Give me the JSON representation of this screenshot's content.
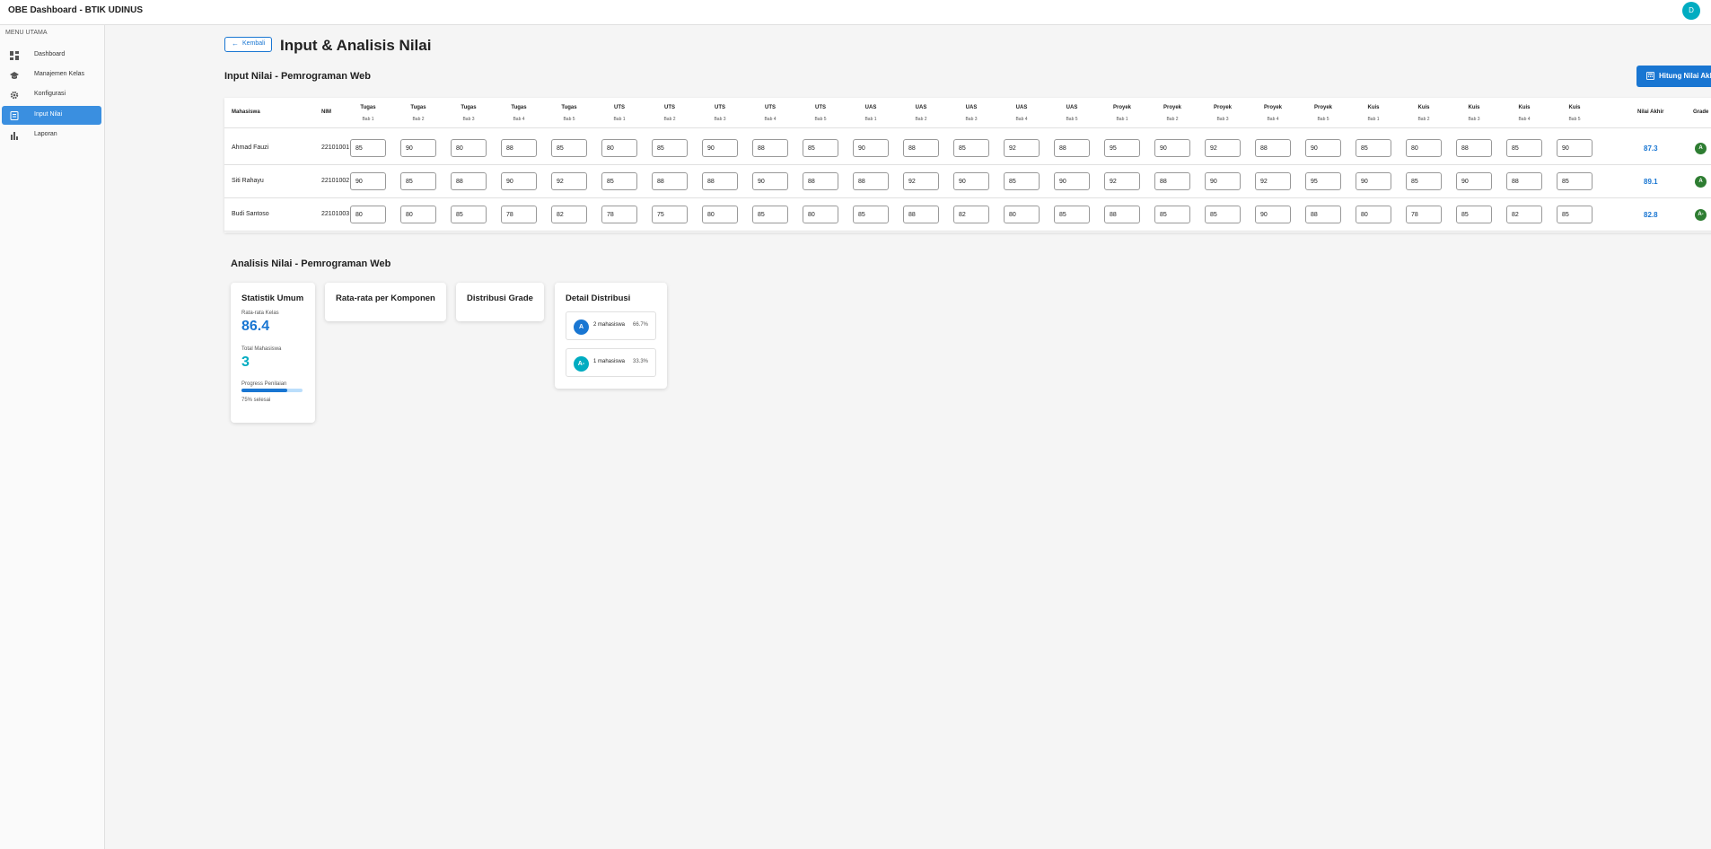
{
  "app": {
    "title": "OBE Dashboard - BTIK UDINUS",
    "avatar_initial": "D"
  },
  "sidebar": {
    "heading": "MENU UTAMA",
    "items": [
      {
        "label": "Dashboard",
        "icon": "dashboard-icon"
      },
      {
        "label": "Manajemen Kelas",
        "icon": "school-icon"
      },
      {
        "label": "Konfigurasi",
        "icon": "gear-icon"
      },
      {
        "label": "Input Nilai",
        "icon": "grade-icon",
        "active": true
      },
      {
        "label": "Laporan",
        "icon": "bar-chart-icon"
      }
    ]
  },
  "header": {
    "back_label": "Kembali",
    "title": "Input & Analisis Nilai"
  },
  "input_section": {
    "title": "Input Nilai - Pemrograman Web",
    "button_label": "Hitung Nilai Akhir"
  },
  "table": {
    "col_mahasiswa": "Mahasiswa",
    "col_nim": "NIM",
    "col_final": "Nilai Akhir",
    "col_grade": "Grade",
    "components": [
      {
        "top": "Tugas",
        "sub": "Bab 1"
      },
      {
        "top": "Tugas",
        "sub": "Bab 2"
      },
      {
        "top": "Tugas",
        "sub": "Bab 3"
      },
      {
        "top": "Tugas",
        "sub": "Bab 4"
      },
      {
        "top": "Tugas",
        "sub": "Bab 5"
      },
      {
        "top": "UTS",
        "sub": "Bab 1"
      },
      {
        "top": "UTS",
        "sub": "Bab 2"
      },
      {
        "top": "UTS",
        "sub": "Bab 3"
      },
      {
        "top": "UTS",
        "sub": "Bab 4"
      },
      {
        "top": "UTS",
        "sub": "Bab 5"
      },
      {
        "top": "UAS",
        "sub": "Bab 1"
      },
      {
        "top": "UAS",
        "sub": "Bab 2"
      },
      {
        "top": "UAS",
        "sub": "Bab 3"
      },
      {
        "top": "UAS",
        "sub": "Bab 4"
      },
      {
        "top": "UAS",
        "sub": "Bab 5"
      },
      {
        "top": "Proyek",
        "sub": "Bab 1"
      },
      {
        "top": "Proyek",
        "sub": "Bab 2"
      },
      {
        "top": "Proyek",
        "sub": "Bab 3"
      },
      {
        "top": "Proyek",
        "sub": "Bab 4"
      },
      {
        "top": "Proyek",
        "sub": "Bab 5"
      },
      {
        "top": "Kuis",
        "sub": "Bab 1"
      },
      {
        "top": "Kuis",
        "sub": "Bab 2"
      },
      {
        "top": "Kuis",
        "sub": "Bab 3"
      },
      {
        "top": "Kuis",
        "sub": "Bab 4"
      },
      {
        "top": "Kuis",
        "sub": "Bab 5"
      }
    ],
    "rows": [
      {
        "name": "Ahmad Fauzi",
        "nim": "22101001",
        "scores": [
          "85",
          "90",
          "80",
          "88",
          "85",
          "80",
          "85",
          "90",
          "88",
          "85",
          "90",
          "88",
          "85",
          "92",
          "88",
          "95",
          "90",
          "92",
          "88",
          "90",
          "85",
          "80",
          "88",
          "85",
          "90"
        ],
        "final": "87.3",
        "grade": "A"
      },
      {
        "name": "Siti Rahayu",
        "nim": "22101002",
        "scores": [
          "90",
          "85",
          "88",
          "90",
          "92",
          "85",
          "88",
          "88",
          "90",
          "88",
          "88",
          "92",
          "90",
          "85",
          "90",
          "92",
          "88",
          "90",
          "92",
          "95",
          "90",
          "85",
          "90",
          "88",
          "85"
        ],
        "final": "89.1",
        "grade": "A"
      },
      {
        "name": "Budi Santoso",
        "nim": "22101003",
        "scores": [
          "80",
          "80",
          "85",
          "78",
          "82",
          "78",
          "75",
          "80",
          "85",
          "80",
          "85",
          "88",
          "82",
          "80",
          "85",
          "88",
          "85",
          "85",
          "90",
          "88",
          "80",
          "78",
          "85",
          "82",
          "85"
        ],
        "final": "82.8",
        "grade": "A-"
      }
    ]
  },
  "analysis": {
    "title": "Analisis Nilai - Pemrograman Web",
    "stats": {
      "title": "Statistik Umum",
      "avg_label": "Rata-rata Kelas",
      "avg_value": "86.4",
      "total_label": "Total Mahasiswa",
      "total_value": "3",
      "progress_label": "Progress Penilaian",
      "progress_value": 75,
      "progress_text": "75% selesai"
    },
    "component_avg_title": "Rata-rata per Komponen",
    "grade_dist_title": "Distribusi Grade",
    "detail": {
      "title": "Detail Distribusi",
      "items": [
        {
          "grade": "A",
          "count": "2 mahasiswa",
          "pct": "66.7%",
          "color": "#1976d2"
        },
        {
          "grade": "A-",
          "count": "1 mahasiswa",
          "pct": "33.3%",
          "color": "#00acc1"
        }
      ]
    }
  },
  "colors": {
    "primary": "#1976d2",
    "accent": "#00acc1",
    "grade_green": "#2e7d32"
  }
}
